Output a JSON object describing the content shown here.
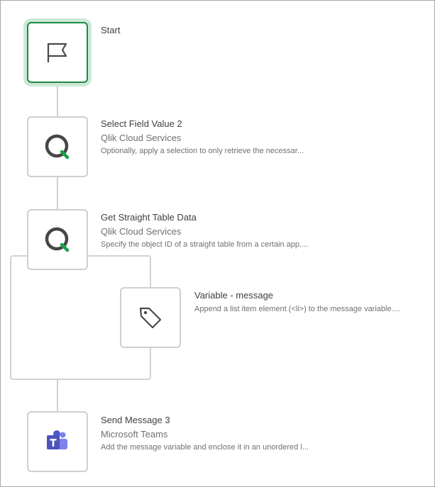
{
  "flow": {
    "start": {
      "title": "Start",
      "icon": "flag-icon"
    },
    "select_field": {
      "title": "Select Field Value 2",
      "service": "Qlik Cloud Services",
      "description": "Optionally, apply a selection to only retrieve the necessar...",
      "icon": "qlik-icon"
    },
    "get_table": {
      "title": "Get Straight Table Data",
      "service": "Qlik Cloud Services",
      "description": "Specify the object ID of a straight table from a certain app....",
      "icon": "qlik-icon"
    },
    "variable": {
      "title": "Variable - message",
      "description": "Append a list item element (<li>) to the message variable....",
      "icon": "tag-icon"
    },
    "send_message": {
      "title": "Send Message 3",
      "service": "Microsoft Teams",
      "description": "Add the message variable and enclose it in an unordered l...",
      "icon": "teams-icon"
    }
  },
  "colors": {
    "selected_border": "#1a8a4a",
    "selected_halo": "#cde9d6",
    "qlik_green": "#17a34a",
    "teams_purple": "#5059c9"
  }
}
